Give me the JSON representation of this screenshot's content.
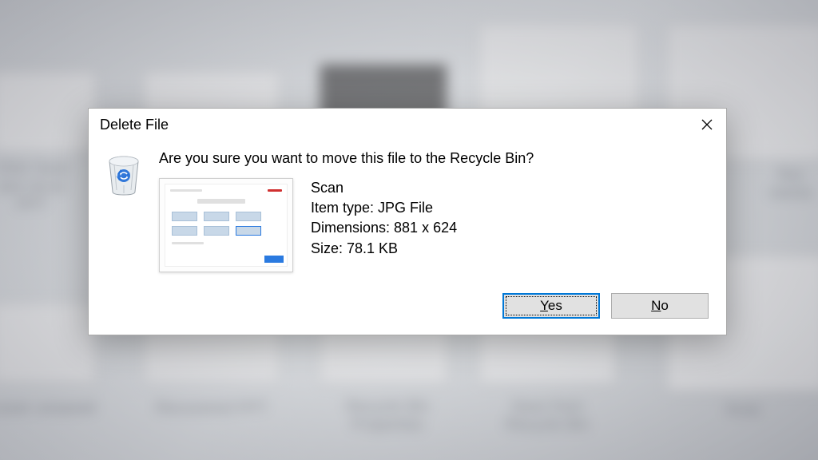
{
  "dialog": {
    "title": "Delete File",
    "question": "Are you sure you want to move this file to the Recycle Bin?",
    "file": {
      "name": "Scan",
      "type_label": "Item type: JPG File",
      "dimensions_label": "Dimensions: 881 x 624",
      "size_label": "Size: 78.1 KB"
    },
    "buttons": {
      "yes": "Yes",
      "no": "No"
    }
  },
  "background": {
    "labels": [
      "Click Save\nave recov\nPPT",
      "Recovered PPT",
      "Recycle Bin\nProperties",
      "Save from\nRecycle Bin",
      "Scan",
      "fice\nments",
      "cover unsaved"
    ]
  }
}
